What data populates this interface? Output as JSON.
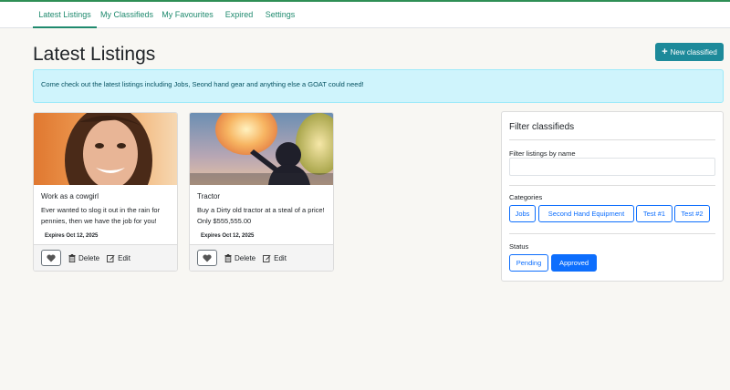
{
  "nav": {
    "tabs": [
      {
        "label": "Latest Listings",
        "active": true
      },
      {
        "label": "My Classifieds",
        "active": false
      },
      {
        "label": "My Favourites",
        "active": false
      },
      {
        "label": "Expired",
        "active": false
      },
      {
        "label": "Settings",
        "active": false
      }
    ]
  },
  "page": {
    "title": "Latest Listings",
    "new_button_label": "New classified",
    "alert_text": "Come check out the latest listings including Jobs, Seond hand gear and anything else a GOAT could need!"
  },
  "listings": [
    {
      "title": "Work as a cowgirl",
      "description": "Ever wanted to slog it out in the rain for pennies, then we have the job for you!",
      "expires": "Expires Oct 12, 2025",
      "delete_label": "Delete",
      "edit_label": "Edit"
    },
    {
      "title": "Tractor",
      "description": "Buy a Dirty old tractor at a steal of a price! Only $555,555.00",
      "expires": "Expires Oct 12, 2025",
      "delete_label": "Delete",
      "edit_label": "Edit"
    }
  ],
  "filter": {
    "title": "Filter classifieds",
    "name_label": "Filter listings by name",
    "name_value": "",
    "categories_label": "Categories",
    "categories": [
      "Jobs",
      "Second Hand Equipment",
      "Test #1",
      "Test #2"
    ],
    "status_label": "Status",
    "statuses": [
      {
        "label": "Pending",
        "selected": false
      },
      {
        "label": "Approved",
        "selected": true
      }
    ]
  },
  "colors": {
    "accent_teal": "#1d8a9a",
    "nav_green": "#1f8a6e",
    "primary_blue": "#0d6efd",
    "alert_bg": "#cff4fc"
  },
  "icons": {
    "new_button": "plus-icon",
    "favourite": "heart-icon",
    "delete": "trash-icon",
    "edit": "edit-icon"
  }
}
